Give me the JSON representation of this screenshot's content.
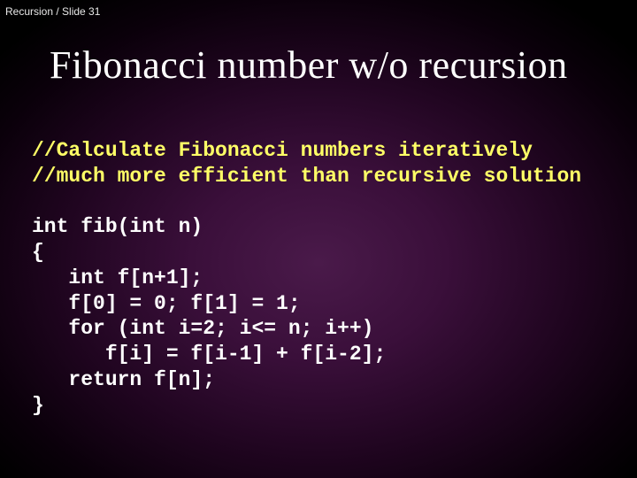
{
  "breadcrumb": "Recursion / Slide 31",
  "title": "Fibonacci number w/o recursion",
  "code": {
    "comment1": "//Calculate Fibonacci numbers iteratively",
    "comment2": "//much more efficient than recursive solution",
    "line1": "int fib(int n)",
    "line2": "{",
    "line3": "   int f[n+1];",
    "line4": "   f[0] = 0; f[1] = 1;",
    "line5": "   for (int i=2; i<= n; i++)",
    "line6": "      f[i] = f[i-1] + f[i-2];",
    "line7": "   return f[n];",
    "line8": "}"
  }
}
